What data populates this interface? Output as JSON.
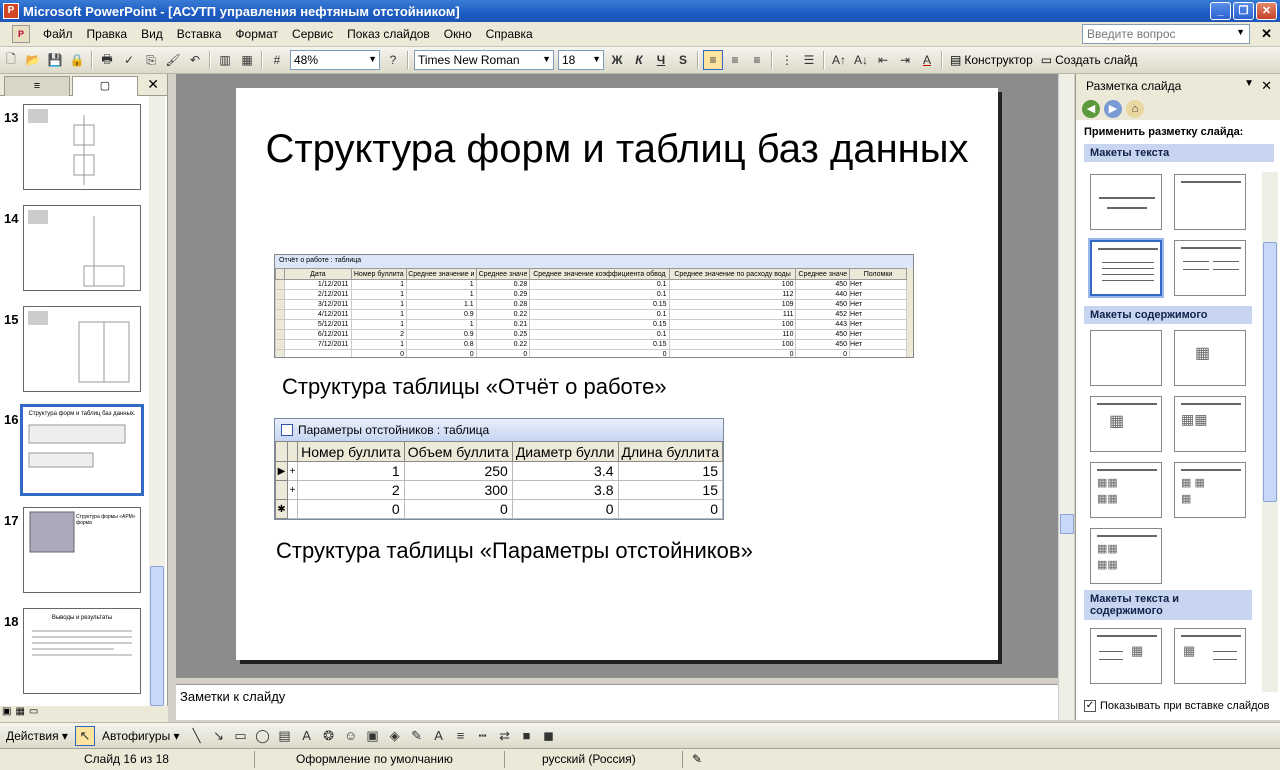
{
  "window": {
    "title": "Microsoft PowerPoint - [АСУТП управления нефтяным отстойником]",
    "minimize": "_",
    "restore": "❐",
    "close": "✕"
  },
  "menu": {
    "items": [
      "Файл",
      "Правка",
      "Вид",
      "Вставка",
      "Формат",
      "Сервис",
      "Показ слайдов",
      "Окно",
      "Справка"
    ],
    "help_placeholder": "Введите вопрос",
    "doc_close": "✕"
  },
  "toolbar": {
    "zoom": "48%",
    "font_name": "Times New Roman",
    "font_size": "18",
    "bold": "Ж",
    "italic": "К",
    "underline": "Ч",
    "shadow": "S",
    "designer": "Конструктор",
    "new_slide": "Создать слайд"
  },
  "left_panel": {
    "tab_outline": "≡",
    "tab_slides": "▢",
    "close": "✕",
    "slides": [
      {
        "num": "13"
      },
      {
        "num": "14"
      },
      {
        "num": "15"
      },
      {
        "num": "16",
        "caption": "Структура форм и таблиц баз данных."
      },
      {
        "num": "17",
        "caption": "Структура формы «АРМ» форма"
      },
      {
        "num": "18",
        "caption": "Выводы и результаты"
      }
    ]
  },
  "slide": {
    "title": "Структура форм и таблиц баз данных",
    "caption1": "Структура таблицы «Отчёт о работе»",
    "caption2": "Структура таблицы «Параметры отстойников»",
    "table1": {
      "caption": "Отчёт о работе : таблица",
      "headers": [
        "Дата",
        "Номер буллита",
        "Среднее значение и",
        "Среднее значе",
        "Среднее значение коэффициента обвод",
        "Среднее значение по расходу воды",
        "Среднее значе",
        "Поломки"
      ],
      "rows": [
        [
          "1/12/2011",
          "1",
          "1",
          "0.28",
          "0.1",
          "100",
          "450",
          "Нет"
        ],
        [
          "2/12/2011",
          "1",
          "1",
          "0.29",
          "0.1",
          "112",
          "440",
          "Нет"
        ],
        [
          "3/12/2011",
          "1",
          "1.1",
          "0.28",
          "0.15",
          "109",
          "450",
          "Нет"
        ],
        [
          "4/12/2011",
          "1",
          "0.9",
          "0.22",
          "0.1",
          "111",
          "452",
          "Нет"
        ],
        [
          "5/12/2011",
          "1",
          "1",
          "0.21",
          "0.15",
          "100",
          "443",
          "Нет"
        ],
        [
          "6/12/2011",
          "2",
          "0.9",
          "0.25",
          "0.1",
          "110",
          "450",
          "Нет"
        ],
        [
          "7/12/2011",
          "1",
          "0.8",
          "0.22",
          "0.15",
          "100",
          "450",
          "Нет"
        ],
        [
          "",
          "0",
          "0",
          "0",
          "0",
          "0",
          "0",
          ""
        ]
      ]
    },
    "table2": {
      "caption": "Параметры отстойников : таблица",
      "headers": [
        "Номер буллита",
        "Объем буллита",
        "Диаметр булли",
        "Длина буллита"
      ],
      "rows": [
        {
          "sel": "▶",
          "exp": "+",
          "cells": [
            "1",
            "250",
            "3.4",
            "15"
          ]
        },
        {
          "sel": "",
          "exp": "+",
          "cells": [
            "2",
            "300",
            "3.8",
            "15"
          ]
        },
        {
          "sel": "✱",
          "exp": "",
          "cells": [
            "0",
            "0",
            "0",
            "0"
          ]
        }
      ]
    }
  },
  "notes": {
    "placeholder": "Заметки к слайду"
  },
  "task_pane": {
    "title": "Разметка слайда",
    "apply_label": "Применить разметку слайда:",
    "group_text": "Макеты текста",
    "group_content": "Макеты содержимого",
    "group_text_content": "Макеты текста и содержимого",
    "show_on_insert": "Показывать при вставке слайдов",
    "checkbox": "✓"
  },
  "drawing": {
    "actions": "Действия",
    "autoshapes": "Автофигуры"
  },
  "status": {
    "slide_info": "Слайд 16 из 18",
    "design": "Оформление по умолчанию",
    "language": "русский (Россия)"
  },
  "colors": {
    "accent": "#316ac5",
    "title_bar": "#1c5bc1"
  }
}
